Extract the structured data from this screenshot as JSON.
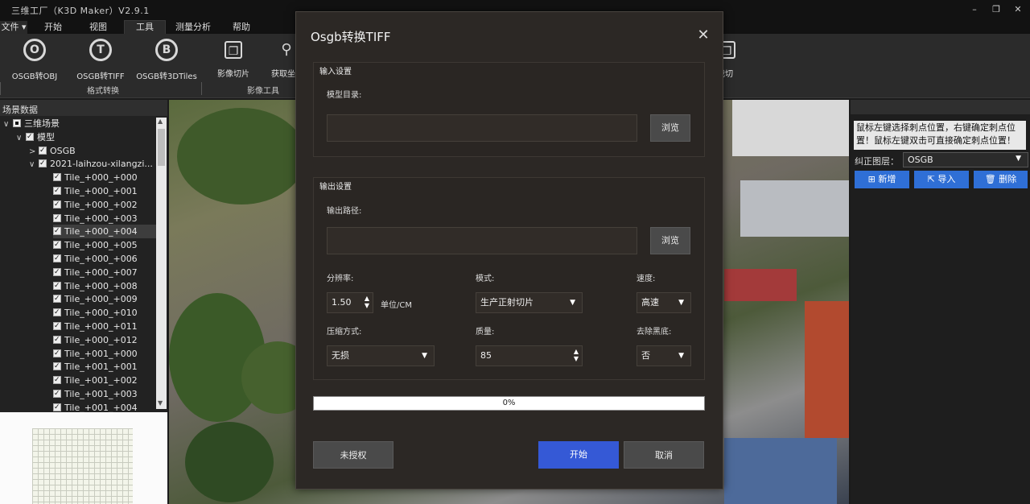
{
  "app": {
    "title": "三维工厂（K3D Maker）V2.9.1"
  },
  "window_controls": {
    "minimize": "–",
    "restore": "❐",
    "close": "✕"
  },
  "menu": {
    "file": "文件",
    "file_arrow": "▾",
    "tabs": [
      "开始",
      "视图",
      "工具",
      "测量分析",
      "帮助"
    ],
    "active_tab": "工具"
  },
  "ribbon": {
    "tools": [
      {
        "label": "OSGB转OBJ",
        "glyph": "O",
        "icon": "osgb-obj-icon"
      },
      {
        "label": "OSGB转TIFF",
        "glyph": "T",
        "icon": "osgb-tiff-icon"
      },
      {
        "label": "OSGB转3DTiles",
        "glyph": "B",
        "icon": "osgb-3dtiles-icon"
      },
      {
        "label": "影像切片",
        "glyph": "❐",
        "icon": "image-slice-icon"
      },
      {
        "label": "获取坐",
        "glyph": "⚲",
        "icon": "get-coordinates-icon"
      },
      {
        "label": "裁切",
        "glyph": "❐",
        "icon": "crop-icon"
      }
    ],
    "groups": [
      "格式转换",
      "影像工具"
    ]
  },
  "left_panel": {
    "header": "场景数据",
    "tree": [
      {
        "label": "三维场景",
        "level": 0,
        "twisty": "∨",
        "check": "square"
      },
      {
        "label": "模型",
        "level": 1,
        "twisty": "∨",
        "check": "checked"
      },
      {
        "label": "OSGB",
        "level": 2,
        "twisty": ">",
        "check": "checked"
      },
      {
        "label": "2021-laihzou-xilangzi...",
        "level": 2,
        "twisty": "∨",
        "check": "checked"
      },
      {
        "label": "Tile_+000_+000",
        "level": 3,
        "check": "checked"
      },
      {
        "label": "Tile_+000_+001",
        "level": 3,
        "check": "checked"
      },
      {
        "label": "Tile_+000_+002",
        "level": 3,
        "check": "checked"
      },
      {
        "label": "Tile_+000_+003",
        "level": 3,
        "check": "checked"
      },
      {
        "label": "Tile_+000_+004",
        "level": 3,
        "check": "checked",
        "selected": true
      },
      {
        "label": "Tile_+000_+005",
        "level": 3,
        "check": "checked"
      },
      {
        "label": "Tile_+000_+006",
        "level": 3,
        "check": "checked"
      },
      {
        "label": "Tile_+000_+007",
        "level": 3,
        "check": "checked"
      },
      {
        "label": "Tile_+000_+008",
        "level": 3,
        "check": "checked"
      },
      {
        "label": "Tile_+000_+009",
        "level": 3,
        "check": "checked"
      },
      {
        "label": "Tile_+000_+010",
        "level": 3,
        "check": "checked"
      },
      {
        "label": "Tile_+000_+011",
        "level": 3,
        "check": "checked"
      },
      {
        "label": "Tile_+000_+012",
        "level": 3,
        "check": "checked"
      },
      {
        "label": "Tile_+001_+000",
        "level": 3,
        "check": "checked"
      },
      {
        "label": "Tile_+001_+001",
        "level": 3,
        "check": "checked"
      },
      {
        "label": "Tile_+001_+002",
        "level": 3,
        "check": "checked"
      },
      {
        "label": "Tile_+001_+003",
        "level": 3,
        "check": "checked"
      },
      {
        "label": "Tile_+001_+004",
        "level": 3,
        "check": "checked"
      }
    ],
    "scroll_up": "▲",
    "scroll_down": "▼"
  },
  "right_panel": {
    "note": "鼠标左键选择刺点位置，右键确定刺点位置！鼠标左键双击可直接确定刺点位置！",
    "layer_label": "纠正图层：",
    "layer_value": "OSGB",
    "buttons": [
      {
        "label": "新增",
        "icon": "add-icon",
        "glyph": "⊞"
      },
      {
        "label": "导入",
        "icon": "import-icon",
        "glyph": "⇱"
      },
      {
        "label": "删除",
        "icon": "delete-icon",
        "glyph": "🗑"
      }
    ]
  },
  "dialog": {
    "title": "Osgb转换TIFF",
    "close": "✕",
    "input_section": {
      "title": "输入设置",
      "model_dir_label": "模型目录:",
      "model_dir_value": "",
      "browse": "浏览"
    },
    "output_section": {
      "title": "输出设置",
      "path_label": "输出路径:",
      "path_value": "",
      "browse": "浏览",
      "resolution_label": "分辨率:",
      "resolution_value": "1.50",
      "resolution_unit": "单位/CM",
      "mode_label": "模式:",
      "mode_value": "生产正射切片",
      "speed_label": "速度:",
      "speed_value": "高速",
      "compression_label": "压缩方式:",
      "compression_value": "无损",
      "quality_label": "质量:",
      "quality_value": "85",
      "remove_black_label": "去除黑底:",
      "remove_black_value": "否"
    },
    "progress": {
      "value": 0,
      "text": "0%"
    },
    "buttons": {
      "unlicensed": "未授权",
      "start": "开始",
      "cancel": "取消"
    },
    "spin_up": "▲",
    "spin_down": "▼",
    "dropdown_arrow": "▼"
  },
  "colors": {
    "accent": "#2f6fd6",
    "start_button": "#3559d6",
    "dialog_bg": "#2c2825"
  }
}
